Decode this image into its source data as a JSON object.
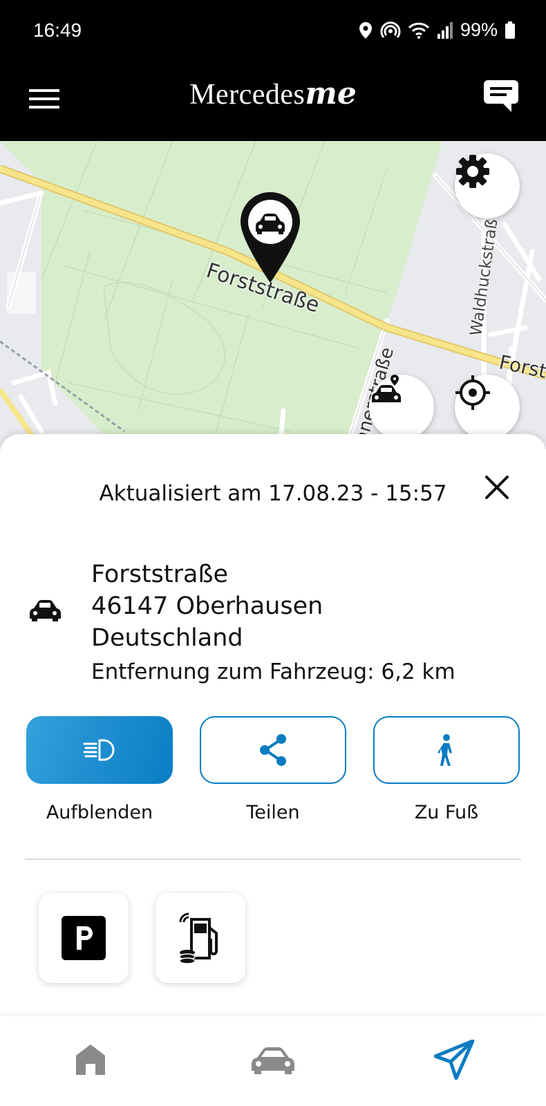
{
  "status_bar": {
    "time": "16:49",
    "battery": "99%"
  },
  "header": {
    "brand_main": "Mercedes",
    "brand_suffix": "me"
  },
  "map": {
    "street_labels": [
      "Forststraße",
      "Waldhuckstraß",
      "Forst",
      "nnerstraße"
    ],
    "colors": {
      "park": "#d7edcc",
      "road": "#f4e58a",
      "urban": "#e8eaed"
    }
  },
  "sheet": {
    "updated_text": "Aktualisiert am 17.08.23 - 15:57",
    "address_lines": [
      "Forststraße",
      "46147 Oberhausen",
      "Deutschland"
    ],
    "distance_text": "Entfernung zum Fahrzeug: 6,2 km",
    "actions": [
      {
        "label": "Aufblenden",
        "icon": "headlight-icon"
      },
      {
        "label": "Teilen",
        "icon": "share-icon"
      },
      {
        "label": "Zu Fuß",
        "icon": "walking-icon"
      }
    ],
    "tiles": [
      {
        "icon": "parking-icon"
      },
      {
        "icon": "fuel-pay-icon"
      }
    ],
    "accent_color": "#0a7cc1"
  },
  "bottom_nav": {
    "items": [
      {
        "icon": "home-icon"
      },
      {
        "icon": "car-icon"
      },
      {
        "icon": "navigate-icon",
        "active": true
      }
    ]
  }
}
